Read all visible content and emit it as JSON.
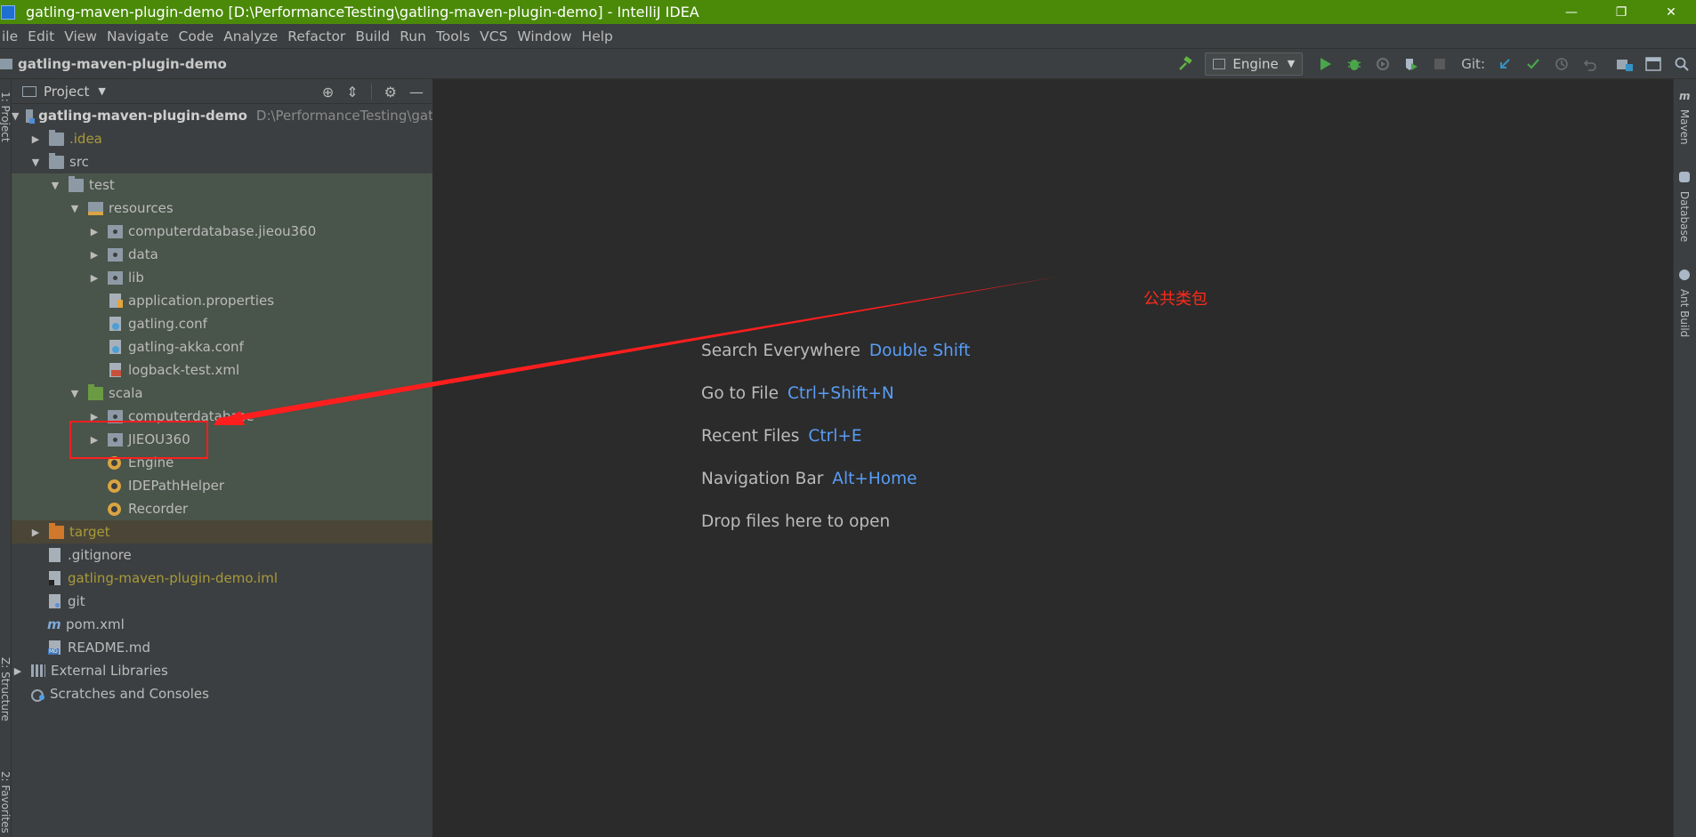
{
  "window": {
    "title": "gatling-maven-plugin-demo [D:\\PerformanceTesting\\gatling-maven-plugin-demo] - IntelliJ IDEA",
    "controls": [
      "—",
      "❐",
      "✕"
    ]
  },
  "menu": [
    "ile",
    "Edit",
    "View",
    "Navigate",
    "Code",
    "Analyze",
    "Refactor",
    "Build",
    "Run",
    "Tools",
    "VCS",
    "Window",
    "Help"
  ],
  "navbar": {
    "breadcrumb": "gatling-maven-plugin-demo",
    "run_config": "Engine",
    "git_label": "Git:"
  },
  "left_tabs": {
    "project": "1: Project",
    "structure": "Z: Structure",
    "favorites": "2: Favorites"
  },
  "project_panel": {
    "view_label": "Project",
    "tree": [
      {
        "label": "gatling-maven-plugin-demo",
        "path": "D:\\PerformanceTesting\\gat"
      },
      {
        "label": ".idea"
      },
      {
        "label": "src"
      },
      {
        "label": "test"
      },
      {
        "label": "resources"
      },
      {
        "label": "computerdatabase.jieou360"
      },
      {
        "label": "data"
      },
      {
        "label": "lib"
      },
      {
        "label": "application.properties"
      },
      {
        "label": "gatling.conf"
      },
      {
        "label": "gatling-akka.conf"
      },
      {
        "label": "logback-test.xml"
      },
      {
        "label": "scala"
      },
      {
        "label": "computerdatabase"
      },
      {
        "label": "JIEOU360"
      },
      {
        "label": "Engine"
      },
      {
        "label": "IDEPathHelper"
      },
      {
        "label": "Recorder"
      },
      {
        "label": "target"
      },
      {
        "label": ".gitignore"
      },
      {
        "label": "gatling-maven-plugin-demo.iml"
      },
      {
        "label": "git"
      },
      {
        "label": "pom.xml"
      },
      {
        "label": "README.md"
      },
      {
        "label": "External Libraries"
      },
      {
        "label": "Scratches and Consoles"
      }
    ]
  },
  "editor_hints": [
    {
      "label": "Search Everywhere",
      "key": "Double Shift"
    },
    {
      "label": "Go to File",
      "key": "Ctrl+Shift+N"
    },
    {
      "label": "Recent Files",
      "key": "Ctrl+E"
    },
    {
      "label": "Navigation Bar",
      "key": "Alt+Home"
    },
    {
      "label": "Drop files here to open",
      "key": ""
    }
  ],
  "right_tabs": {
    "maven": "Maven",
    "database": "Database",
    "ant": "Ant Build"
  },
  "annotation": {
    "text": "公共类包",
    "color": "#ff2a1a"
  },
  "colors": {
    "titlebar": "#4a8a08",
    "panel": "#3c3f41",
    "editor": "#2b2b2b",
    "shortcut": "#589df6"
  }
}
